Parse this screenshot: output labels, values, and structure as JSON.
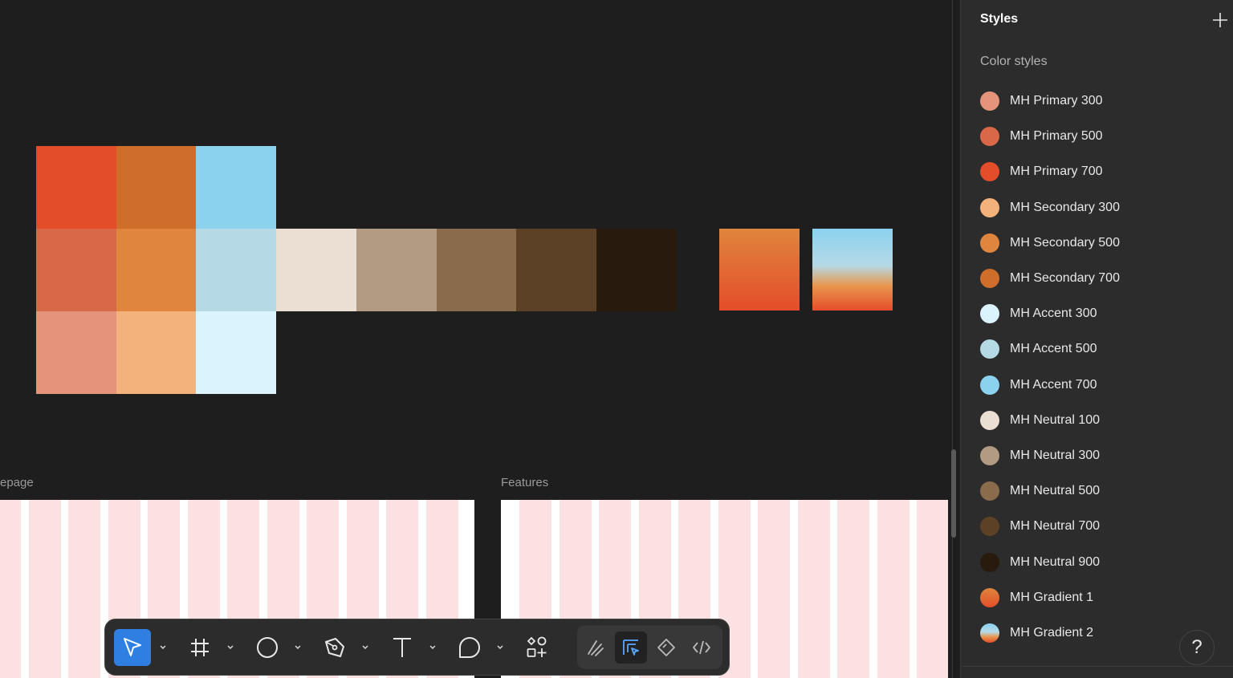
{
  "canvas": {
    "frames": [
      {
        "label": "epage"
      },
      {
        "label": "Features"
      }
    ],
    "palette_colors": {
      "primary_700": "#e44d2a",
      "secondary_700": "#ce6e2a",
      "accent_700": "#8bd2ee",
      "primary_500": "#d96848",
      "secondary_500": "#df853d",
      "accent_500": "#b5d9e5",
      "primary_300": "#e5947b",
      "secondary_300": "#f3b27c",
      "accent_300": "#dbf3fc",
      "neutral_100": "#ebdfd4",
      "neutral_300": "#b39a82",
      "neutral_500": "#8a6c4d",
      "neutral_700": "#5d4127",
      "neutral_900": "#281a0d",
      "gradient_1": "linear-gradient(#df853d, #e44d2a)",
      "gradient_2": "linear-gradient(#8bd2ee 0%, #b5d9e5 45%, #e9954d 70%, #e44d2a 100%)"
    }
  },
  "styles_panel": {
    "title": "Styles",
    "section_label": "Color styles",
    "color_styles": [
      {
        "name": "MH Primary 300",
        "color": "#e5947b"
      },
      {
        "name": "MH Primary 500",
        "color": "#d96848"
      },
      {
        "name": "MH Primary 700",
        "color": "#e44d2a"
      },
      {
        "name": "MH Secondary 300",
        "color": "#f3b27c"
      },
      {
        "name": "MH Secondary 500",
        "color": "#df853d"
      },
      {
        "name": "MH Secondary 700",
        "color": "#ce6e2a"
      },
      {
        "name": "MH Accent 300",
        "color": "#dbf3fc"
      },
      {
        "name": "MH Accent 500",
        "color": "#b5d9e5"
      },
      {
        "name": "MH Accent 700",
        "color": "#8bd2ee"
      },
      {
        "name": "MH Neutral 100",
        "color": "#ebdfd4"
      },
      {
        "name": "MH Neutral 300",
        "color": "#b39a82"
      },
      {
        "name": "MH Neutral 500",
        "color": "#8a6c4d"
      },
      {
        "name": "MH Neutral 700",
        "color": "#5d4127"
      },
      {
        "name": "MH Neutral 900",
        "color": "#281a0d"
      },
      {
        "name": "MH Gradient 1",
        "color": "linear-gradient(#df853d, #e44d2a)"
      },
      {
        "name": "MH Gradient 2",
        "color": "linear-gradient(#8bd2ee, #b5d9e5 45%, #e9954d 70%, #e44d2a)"
      }
    ],
    "help_label": "?"
  },
  "toolbar": {
    "tools": [
      "move-tool",
      "frame-tool",
      "ellipse-tool",
      "pen-tool",
      "text-tool",
      "comment-tool",
      "assets-tool"
    ],
    "modes": [
      "draw-mode",
      "design-mode",
      "prototype-mode",
      "dev-mode"
    ],
    "active_tool": "move-tool",
    "active_mode": "design-mode"
  }
}
